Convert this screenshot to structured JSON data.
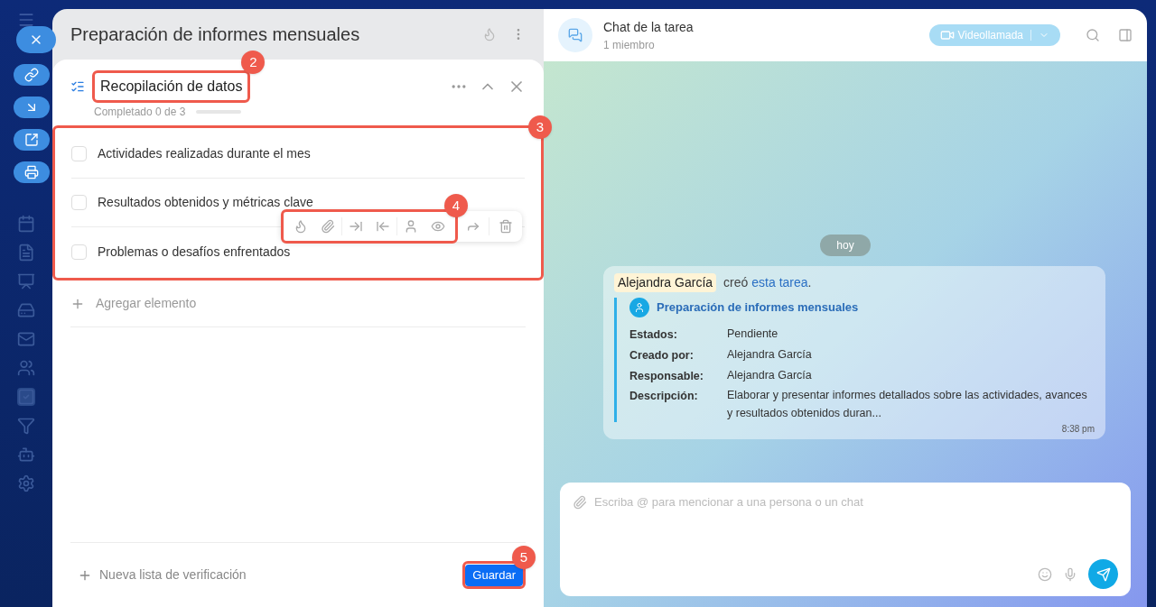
{
  "task": {
    "title": "Preparación de informes mensuales"
  },
  "checklist": {
    "title": "Recopilación de datos",
    "title_callout": "2",
    "progress_text": "Completado 0 de 3",
    "level": 0,
    "items_callout": "3",
    "items": [
      {
        "text": "Actividades realizadas durante el mes",
        "checked": false
      },
      {
        "text": "Resultados obtenidos y métricas clave",
        "checked": false
      },
      {
        "text": "Problemas o desafíos enfrentados",
        "checked": false
      }
    ],
    "toolbar_callout": "4",
    "add_item": "Agregar elemento"
  },
  "footer": {
    "new_checklist": "Nueva lista de verificación",
    "save": "Guardar",
    "save_callout": "5"
  },
  "chat": {
    "title": "Chat de la tarea",
    "subtitle": "1 miembro",
    "video_button": "Videollamada",
    "day": "hoy",
    "message": {
      "author": "Alejandra García",
      "verb": "creó",
      "link": "esta tarea",
      "punct": ".",
      "task_title": "Preparación de informes mensuales",
      "fields": [
        {
          "label": "Estados:",
          "value": "Pendiente"
        },
        {
          "label": "Creado por:",
          "value": "Alejandra García"
        },
        {
          "label": "Responsable:",
          "value": "Alejandra García"
        },
        {
          "label": "Descripción:",
          "value": "Elaborar y presentar informes detallados sobre las actividades, avances y resultados obtenidos duran..."
        }
      ],
      "time": "8:38 pm"
    },
    "input_placeholder": "Escriba @ para mencionar a una persona o un chat"
  }
}
